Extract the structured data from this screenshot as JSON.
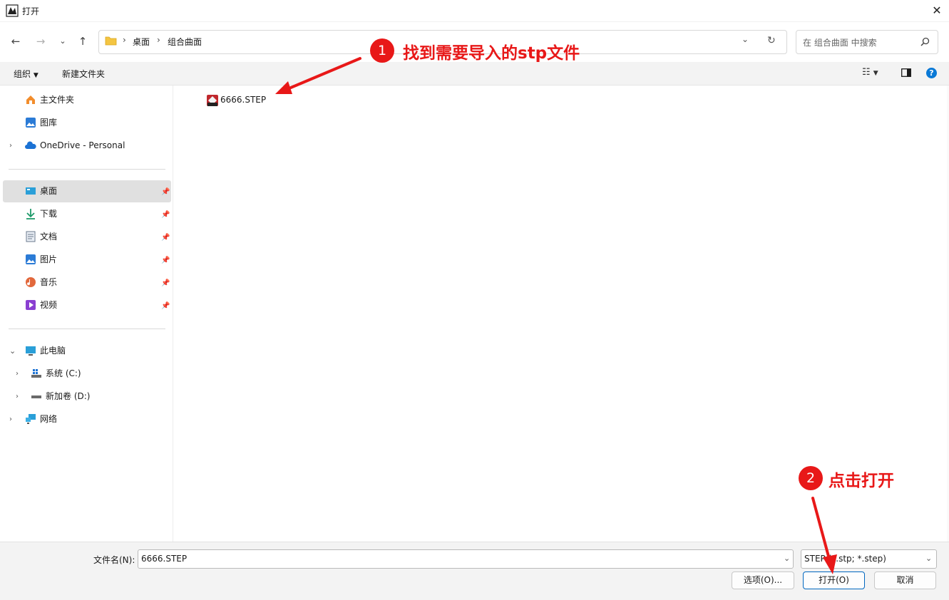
{
  "window": {
    "title": "打开",
    "close_label": "✕"
  },
  "nav": {
    "breadcrumbs": [
      "桌面",
      "组合曲面"
    ],
    "search_placeholder": "在 组合曲面 中搜索"
  },
  "toolbar": {
    "organize_label": "组织",
    "new_folder_label": "新建文件夹"
  },
  "sidebar": {
    "quick": [
      {
        "label": "主文件夹",
        "icon": "home-icon"
      },
      {
        "label": "图库",
        "icon": "gallery-icon"
      },
      {
        "label": "OneDrive - Personal",
        "icon": "cloud-icon"
      }
    ],
    "pinned": [
      {
        "label": "桌面",
        "icon": "desktop-icon"
      },
      {
        "label": "下载",
        "icon": "download-icon"
      },
      {
        "label": "文档",
        "icon": "document-icon"
      },
      {
        "label": "图片",
        "icon": "picture-icon"
      },
      {
        "label": "音乐",
        "icon": "music-icon"
      },
      {
        "label": "视频",
        "icon": "video-icon"
      }
    ],
    "computer": [
      {
        "label": "此电脑",
        "icon": "pc-icon"
      },
      {
        "label": "系统 (C:)",
        "icon": "drive-c-icon"
      },
      {
        "label": "新加卷 (D:)",
        "icon": "drive-d-icon"
      },
      {
        "label": "网络",
        "icon": "network-icon"
      }
    ]
  },
  "files": [
    {
      "name": "6666.STEP",
      "icon": "step-file-icon"
    }
  ],
  "footer": {
    "filename_label": "文件名(N):",
    "filename_value": "6666.STEP",
    "filetype_value": "STEP (*.stp; *.step)",
    "options_label": "选项(O)...",
    "open_label": "打开(O)",
    "cancel_label": "取消"
  },
  "annotations": [
    {
      "number": "1",
      "text": "找到需要导入的stp文件"
    },
    {
      "number": "2",
      "text": "点击打开"
    }
  ],
  "colors": {
    "annotation": "#e81818",
    "accent": "#0067c0",
    "selected": "#e0e0e0"
  }
}
